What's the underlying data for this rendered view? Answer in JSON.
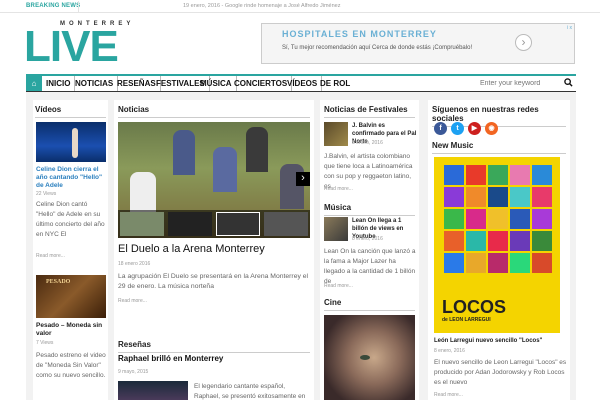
{
  "topbar": {
    "breaking_label": "BREAKING NEWS",
    "ticker": "19 enero, 2016 - Google rinde homenaje a José Alfredo Jiménez"
  },
  "logo": {
    "small": "MONTERREY",
    "big": "LIVE"
  },
  "ad": {
    "title": "HOSPITALES EN MONTERREY",
    "text": "Sí, Tu mejor recomendación aquí Cerca de donde estás ¡Compruébalo!",
    "arrow": "›",
    "info": "i x"
  },
  "nav": {
    "home_icon": "⌂",
    "items": [
      "INICIO",
      "NOTICIAS",
      "RESEÑAS",
      "FESTIVALES",
      "MÚSICA",
      "CONCIERTOS",
      "VÍDEOS",
      "DE ROL"
    ],
    "search_placeholder": "Enter your keyword",
    "search_icon": "🔍"
  },
  "videos": {
    "heading": "Vídeos",
    "items": [
      {
        "title": "Celine Dion cierra el año cantando \"Hello\" de Adele",
        "views": "22 Views",
        "text": "Celine Dion cantó \"Hello\" de Adele en su último concierto del año en NYC El",
        "more": "Read more..."
      },
      {
        "title": "Pesado – Moneda sin valor",
        "views": "7 Views",
        "text": "Pesado estreno el video de \"Moneda Sin Valor\" como su nuevo sencillo.",
        "more": "Read more..."
      }
    ]
  },
  "noticias": {
    "heading": "Noticias",
    "title": "El Duelo a la Arena Monterrey",
    "date": "18 enero 2016",
    "text": "La agrupación El Duelo se presentará en la Arena Monterrey el 29 de enero. La música norteña",
    "more": "Read more...",
    "arrow_left": "‹",
    "arrow_right": "›"
  },
  "resenas": {
    "heading": "Reseñas",
    "title": "Raphael brilló en Monterrey",
    "date": "9 mayo, 2015",
    "text": "El legendario cantante español, Raphael, se presentó exitosamente en"
  },
  "festivales": {
    "heading": "Noticias de Festivales",
    "title": "J. Balvin es confirmado para el Pal Norte",
    "date": "8 enero, 2016",
    "text": "J.Balvin, el artista colombiano que tiene loca a Latinoamérica con su pop y reggaeton latino, es",
    "more": "Read more..."
  },
  "musica": {
    "heading": "Música",
    "title": "Lean On llega a 1 billón de views en Youtube",
    "date": "8 enero, 2016",
    "text": "Lean On la canción que lanzó a la fama a Major Lazer ha llegado a la cantidad de 1 billón de",
    "more": "Read more..."
  },
  "cine": {
    "heading": "Cine"
  },
  "social": {
    "heading": "Síguenos en nuestras redes sociales",
    "icons": [
      "f",
      "t",
      "▶",
      "◉"
    ],
    "colors": {
      "facebook": "#3b5998",
      "twitter": "#1da1f2",
      "youtube": "#cd201f",
      "rss": "#f26522"
    }
  },
  "newmusic": {
    "heading": "New Music",
    "album_title": "LOCOS",
    "album_artist": "de LEON LARREGUI",
    "title": "León Larregui nuevo sencillo \"Locos\"",
    "date": "8 enero, 2016",
    "text": "El nuevo sencillo de Leon Larregui \"Locos\" es producido por Adan Jodorowsky y Rob Locos es el nuevo",
    "more": "Read more..."
  },
  "colors": {
    "accent": "#2aa5a0"
  }
}
